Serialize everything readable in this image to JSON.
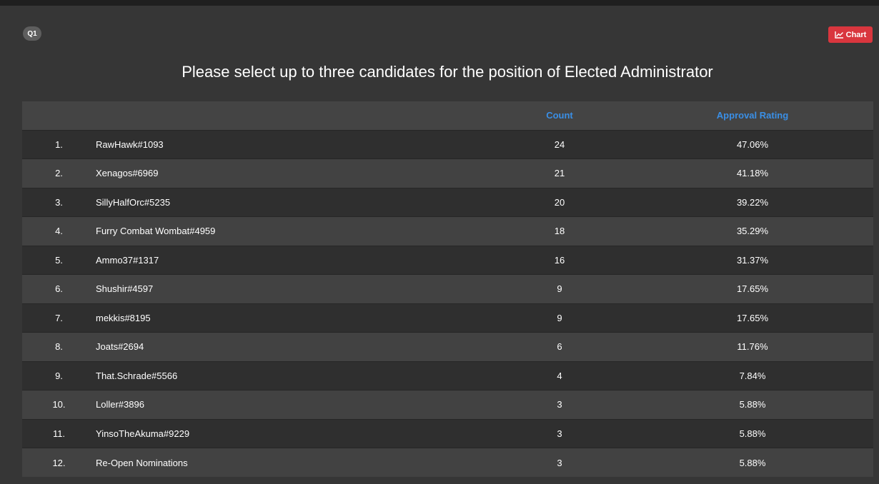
{
  "question_badge": "Q1",
  "chart_button": {
    "label": "Chart",
    "icon": "line-chart-icon",
    "color": "#d9363e"
  },
  "title": "Please select up to three candidates for the position of Elected Administrator",
  "table": {
    "headers": {
      "rank": "",
      "name": "",
      "count": "Count",
      "rating": "Approval Rating"
    },
    "header_color": "#3a8fe6",
    "rows": [
      {
        "rank": "1.",
        "name": "RawHawk#1093",
        "count": "24",
        "rating": "47.06%"
      },
      {
        "rank": "2.",
        "name": "Xenagos#6969",
        "count": "21",
        "rating": "41.18%"
      },
      {
        "rank": "3.",
        "name": "SillyHalfOrc#5235",
        "count": "20",
        "rating": "39.22%"
      },
      {
        "rank": "4.",
        "name": "Furry Combat Wombat#4959",
        "count": "18",
        "rating": "35.29%"
      },
      {
        "rank": "5.",
        "name": "Ammo37#1317",
        "count": "16",
        "rating": "31.37%"
      },
      {
        "rank": "6.",
        "name": "Shushir#4597",
        "count": "9",
        "rating": "17.65%"
      },
      {
        "rank": "7.",
        "name": "mekkis#8195",
        "count": "9",
        "rating": "17.65%"
      },
      {
        "rank": "8.",
        "name": "Joats#2694",
        "count": "6",
        "rating": "11.76%"
      },
      {
        "rank": "9.",
        "name": "That.Schrade#5566",
        "count": "4",
        "rating": "7.84%"
      },
      {
        "rank": "10.",
        "name": "Loller#3896",
        "count": "3",
        "rating": "5.88%"
      },
      {
        "rank": "11.",
        "name": "YinsoTheAkuma#9229",
        "count": "3",
        "rating": "5.88%"
      },
      {
        "rank": "12.",
        "name": "Re-Open Nominations",
        "count": "3",
        "rating": "5.88%"
      }
    ]
  }
}
